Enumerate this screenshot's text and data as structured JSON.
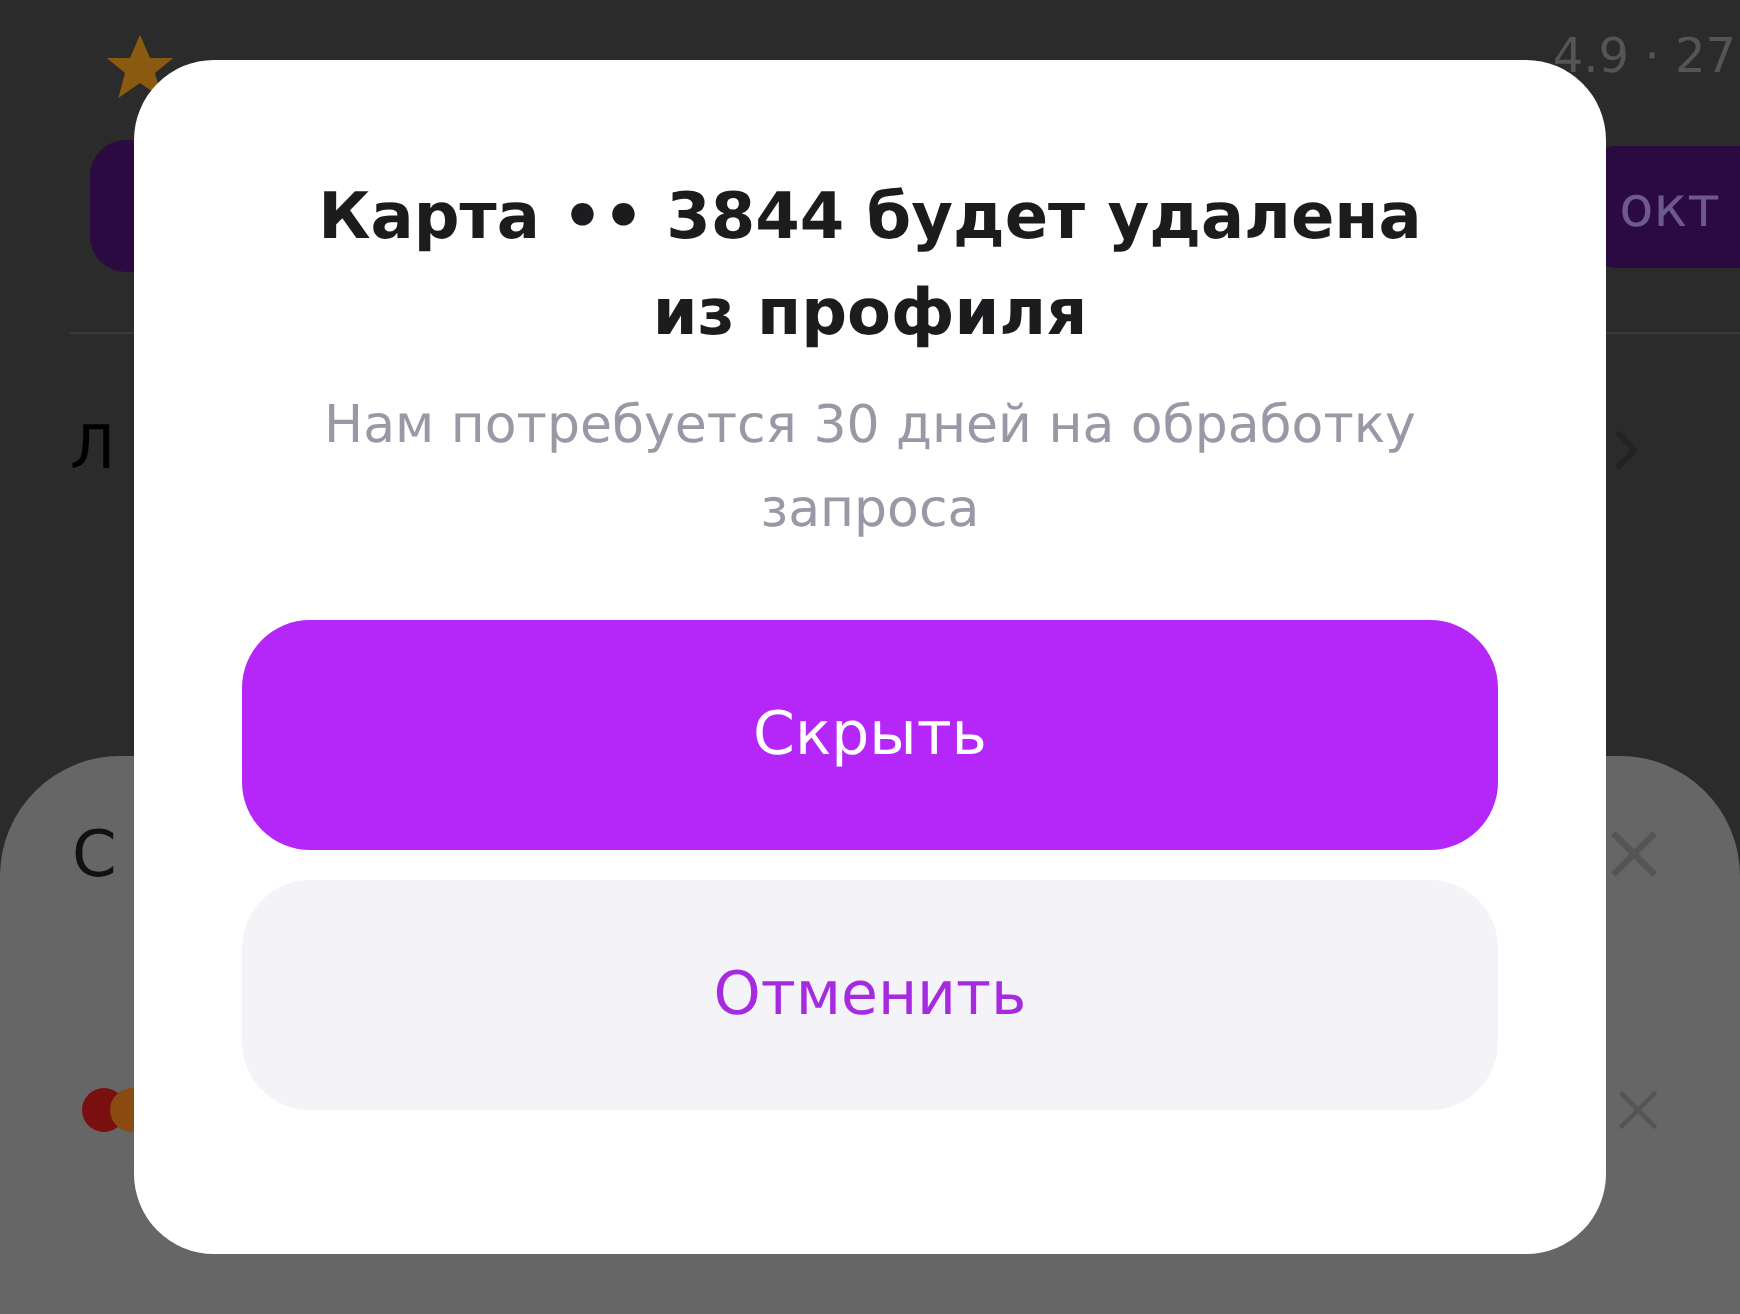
{
  "background": {
    "rating": "4.9 · 27",
    "date_badge": "окт",
    "row_label": "Л"
  },
  "sheet": {
    "title": "С"
  },
  "dialog": {
    "title": "Карта •• 3844 будет удалена из профиля",
    "message": "Нам потребуется 30 дней на обработку запроса",
    "buttons": [
      {
        "label": "Скрыть",
        "kind": "primary"
      },
      {
        "label": "Отменить",
        "kind": "secondary"
      }
    ]
  }
}
